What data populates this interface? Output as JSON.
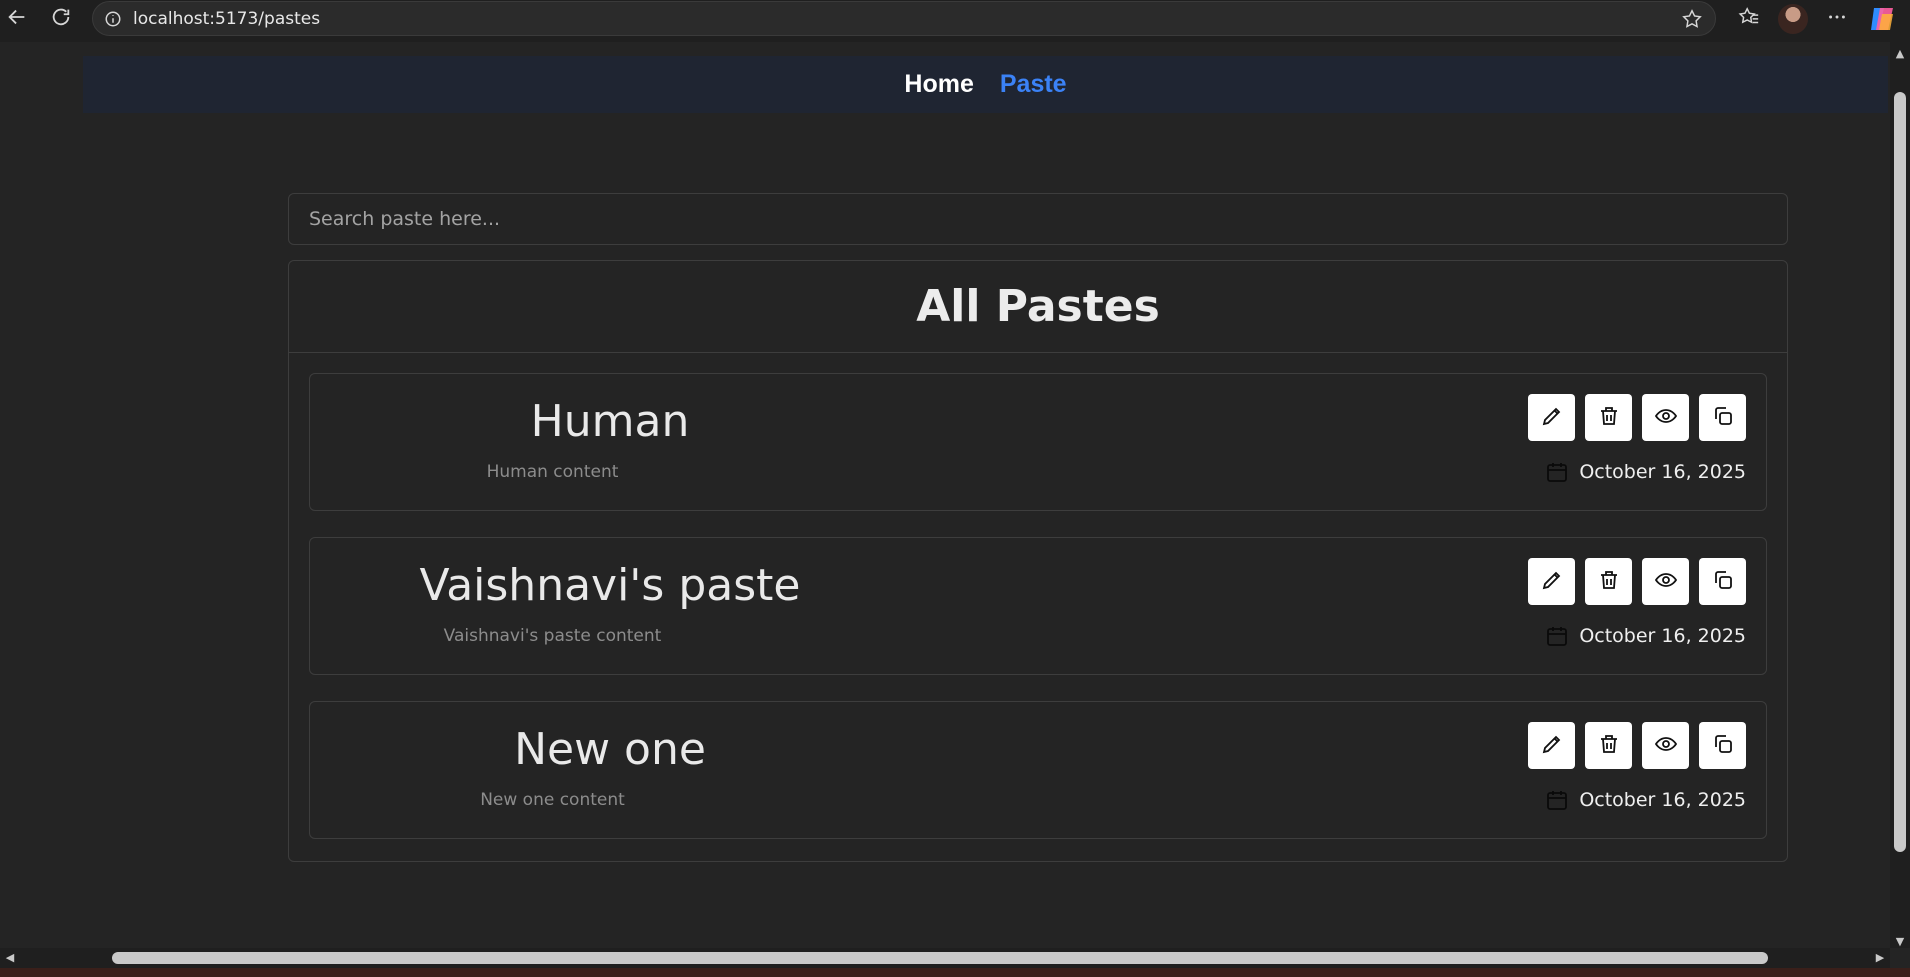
{
  "browser": {
    "url": "localhost:5173/pastes",
    "icons": {
      "back": "back-arrow-icon",
      "reload": "reload-icon",
      "info": "info-icon",
      "star": "star-icon",
      "favorites": "favorites-icon",
      "more": "more-icon",
      "copilot": "copilot-icon"
    }
  },
  "nav": {
    "home_label": "Home",
    "paste_label": "Paste",
    "active_color": "#3b82f6"
  },
  "search": {
    "placeholder": "Search paste here...",
    "value": ""
  },
  "list": {
    "title": "All Pastes",
    "pastes": [
      {
        "title": "Human",
        "content": "Human content",
        "date": "October 16, 2025"
      },
      {
        "title": "Vaishnavi's paste",
        "content": "Vaishnavi's paste content",
        "date": "October 16, 2025"
      },
      {
        "title": "New one",
        "content": "New one content",
        "date": "October 16, 2025"
      }
    ],
    "actions": [
      "edit",
      "delete",
      "view",
      "copy"
    ]
  }
}
